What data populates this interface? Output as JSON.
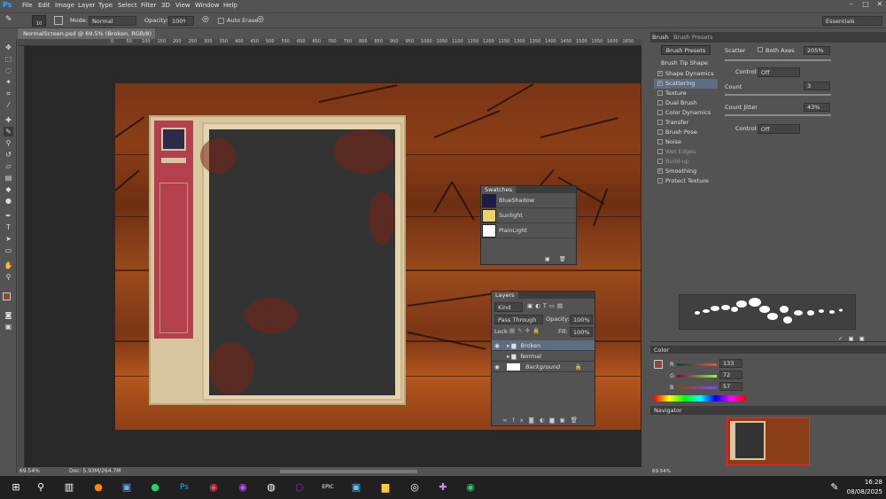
{
  "app": {
    "logo": "Ps"
  },
  "menu": [
    "File",
    "Edit",
    "Image",
    "Layer",
    "Type",
    "Select",
    "Filter",
    "3D",
    "View",
    "Window",
    "Help"
  ],
  "window_controls": {
    "minimize": "–",
    "maximize": "□",
    "close": "✕"
  },
  "options_bar": {
    "brush_size": "10",
    "mode_label": "Mode:",
    "mode_value": "Normal",
    "opacity_label": "Opacity:",
    "opacity_value": "100%",
    "auto_erase_label": "Auto Erase",
    "workspace": "Essentials"
  },
  "document": {
    "tab_title": "NormalScreen.psd @ 69.5% (Broken, RGB/8) *",
    "zoom": "69.54%",
    "doc_info": "Doc: 5.93M/264.7M"
  },
  "ruler_ticks": [
    "0",
    "50",
    "100",
    "150",
    "200",
    "250",
    "300",
    "350",
    "400",
    "450",
    "500",
    "550",
    "600",
    "650",
    "700",
    "750",
    "800",
    "850",
    "900",
    "950",
    "1000",
    "1050",
    "1100",
    "1150",
    "1200",
    "1250",
    "1300",
    "1350",
    "1400",
    "1450",
    "1500",
    "1550",
    "1600",
    "1650"
  ],
  "swatches_panel": {
    "title": "Swatches",
    "items": [
      {
        "name": "BlueShadow",
        "color": "#1c1c4a"
      },
      {
        "name": "Sunlight",
        "color": "#e8d46a"
      },
      {
        "name": "PlainLight",
        "color": "#ffffff"
      }
    ]
  },
  "layers_panel": {
    "title": "Layers",
    "kind_label": "Kind",
    "blend_mode": "Pass Through",
    "opacity_label": "Opacity:",
    "opacity_value": "100%",
    "lock_label": "Lock:",
    "fill_label": "Fill:",
    "fill_value": "100%",
    "layers": [
      {
        "name": "Broken",
        "type": "group",
        "selected": true
      },
      {
        "name": "Normal",
        "type": "group",
        "selected": false
      },
      {
        "name": "Background",
        "type": "layer",
        "selected": false
      }
    ]
  },
  "brush_panel": {
    "tabs": [
      "Brush",
      "Brush Presets"
    ],
    "presets_button": "Brush Presets",
    "tip_shape": "Brush Tip Shape",
    "options": [
      {
        "label": "Shape Dynamics",
        "checked": true
      },
      {
        "label": "Scattering",
        "checked": true,
        "selected": true
      },
      {
        "label": "Texture",
        "checked": false
      },
      {
        "label": "Dual Brush",
        "checked": false
      },
      {
        "label": "Color Dynamics",
        "checked": false
      },
      {
        "label": "Transfer",
        "checked": false
      },
      {
        "label": "Brush Pose",
        "checked": false
      },
      {
        "label": "Noise",
        "checked": false
      },
      {
        "label": "Wet Edges",
        "checked": false
      },
      {
        "label": "Build-up",
        "checked": false
      },
      {
        "label": "Smoothing",
        "checked": true
      },
      {
        "label": "Protect Texture",
        "checked": false
      }
    ],
    "scatter_label": "Scatter",
    "both_axes_label": "Both Axes",
    "scatter_value": "205%",
    "control_label": "Control:",
    "control_value": "Off",
    "count_label": "Count",
    "count_value": "3",
    "count_jitter_label": "Count Jitter",
    "count_jitter_value": "43%",
    "control2_value": "Off"
  },
  "color_panel": {
    "title": "Color",
    "r_label": "R",
    "r_value": "133",
    "g_label": "G",
    "g_value": "72",
    "b_label": "B",
    "b_value": "57",
    "foreground": "#854839",
    "background": "#1e1e50"
  },
  "navigator_panel": {
    "title": "Navigator",
    "zoom": "69.54%"
  },
  "taskbar": {
    "time": "16:28",
    "date": "08/08/2025"
  }
}
